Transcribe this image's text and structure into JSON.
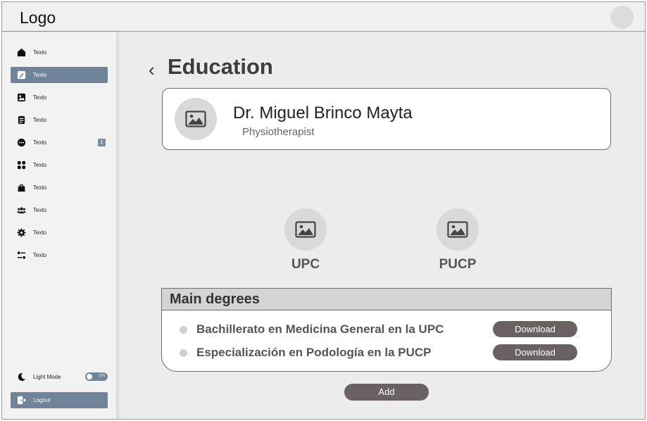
{
  "header": {
    "logo": "Logo"
  },
  "sidebar": {
    "items": [
      {
        "label": "Texto",
        "icon": "home-icon"
      },
      {
        "label": "Texto",
        "icon": "edit-icon",
        "active": true
      },
      {
        "label": "Texto",
        "icon": "image-icon"
      },
      {
        "label": "Texto",
        "icon": "document-icon"
      },
      {
        "label": "Texto",
        "icon": "chat-icon",
        "badge": "1"
      },
      {
        "label": "Texto",
        "icon": "grid-icon"
      },
      {
        "label": "Texto",
        "icon": "bag-icon"
      },
      {
        "label": "Texto",
        "icon": "users-icon"
      },
      {
        "label": "Texto",
        "icon": "gear-icon"
      },
      {
        "label": "Texto",
        "icon": "sliders-icon"
      }
    ],
    "light_mode_label": "Light Mode",
    "toggle_text": "ON",
    "logout_label": "Logout"
  },
  "main": {
    "title": "Education",
    "profile": {
      "name": "Dr. Miguel Brinco Mayta",
      "role": "Physiotherapist"
    },
    "universities": [
      "UPC",
      "PUCP"
    ],
    "degrees": {
      "header": "Main degrees",
      "items": [
        {
          "text": "Bachillerato en Medicina General en la UPC",
          "button": "Download"
        },
        {
          "text": "Especialización en Podología en la PUCP",
          "button": "Download"
        }
      ]
    },
    "add_label": "Add"
  },
  "colors": {
    "accent": "#6f8399",
    "button": "#6a6262",
    "background": "#ececec"
  }
}
